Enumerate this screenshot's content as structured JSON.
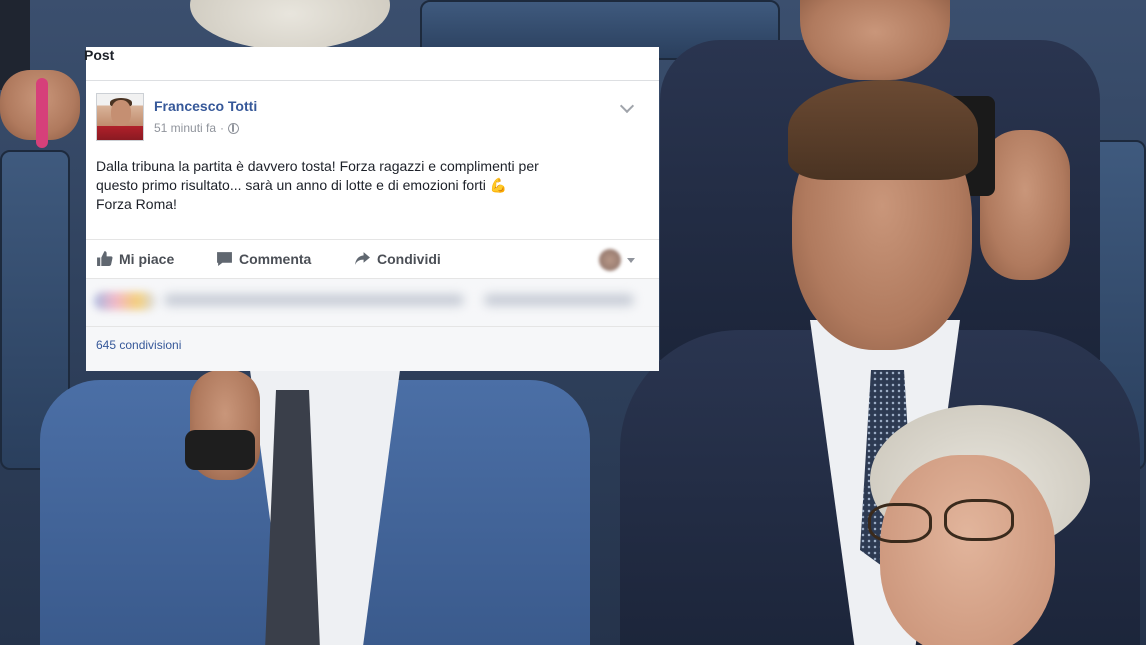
{
  "card": {
    "title": "Post",
    "author": "Francesco Totti",
    "timestamp": "51 minuti fa",
    "privacy_icon": "globe-icon",
    "post_text": "Dalla tribuna la partita è davvero tosta! Forza ragazzi e complimenti per\nquesto primo risultato... sarà un anno di lotte e di emozioni forti",
    "emoji": "💪",
    "post_text_end": "Forza Roma!",
    "actions": {
      "like_label": "Mi piace",
      "comment_label": "Commenta",
      "share_label": "Condividi"
    },
    "shares_count": "645 condivisioni"
  },
  "colors": {
    "link_blue": "#365899",
    "text": "#1d2129",
    "meta_gray": "#90949c"
  }
}
